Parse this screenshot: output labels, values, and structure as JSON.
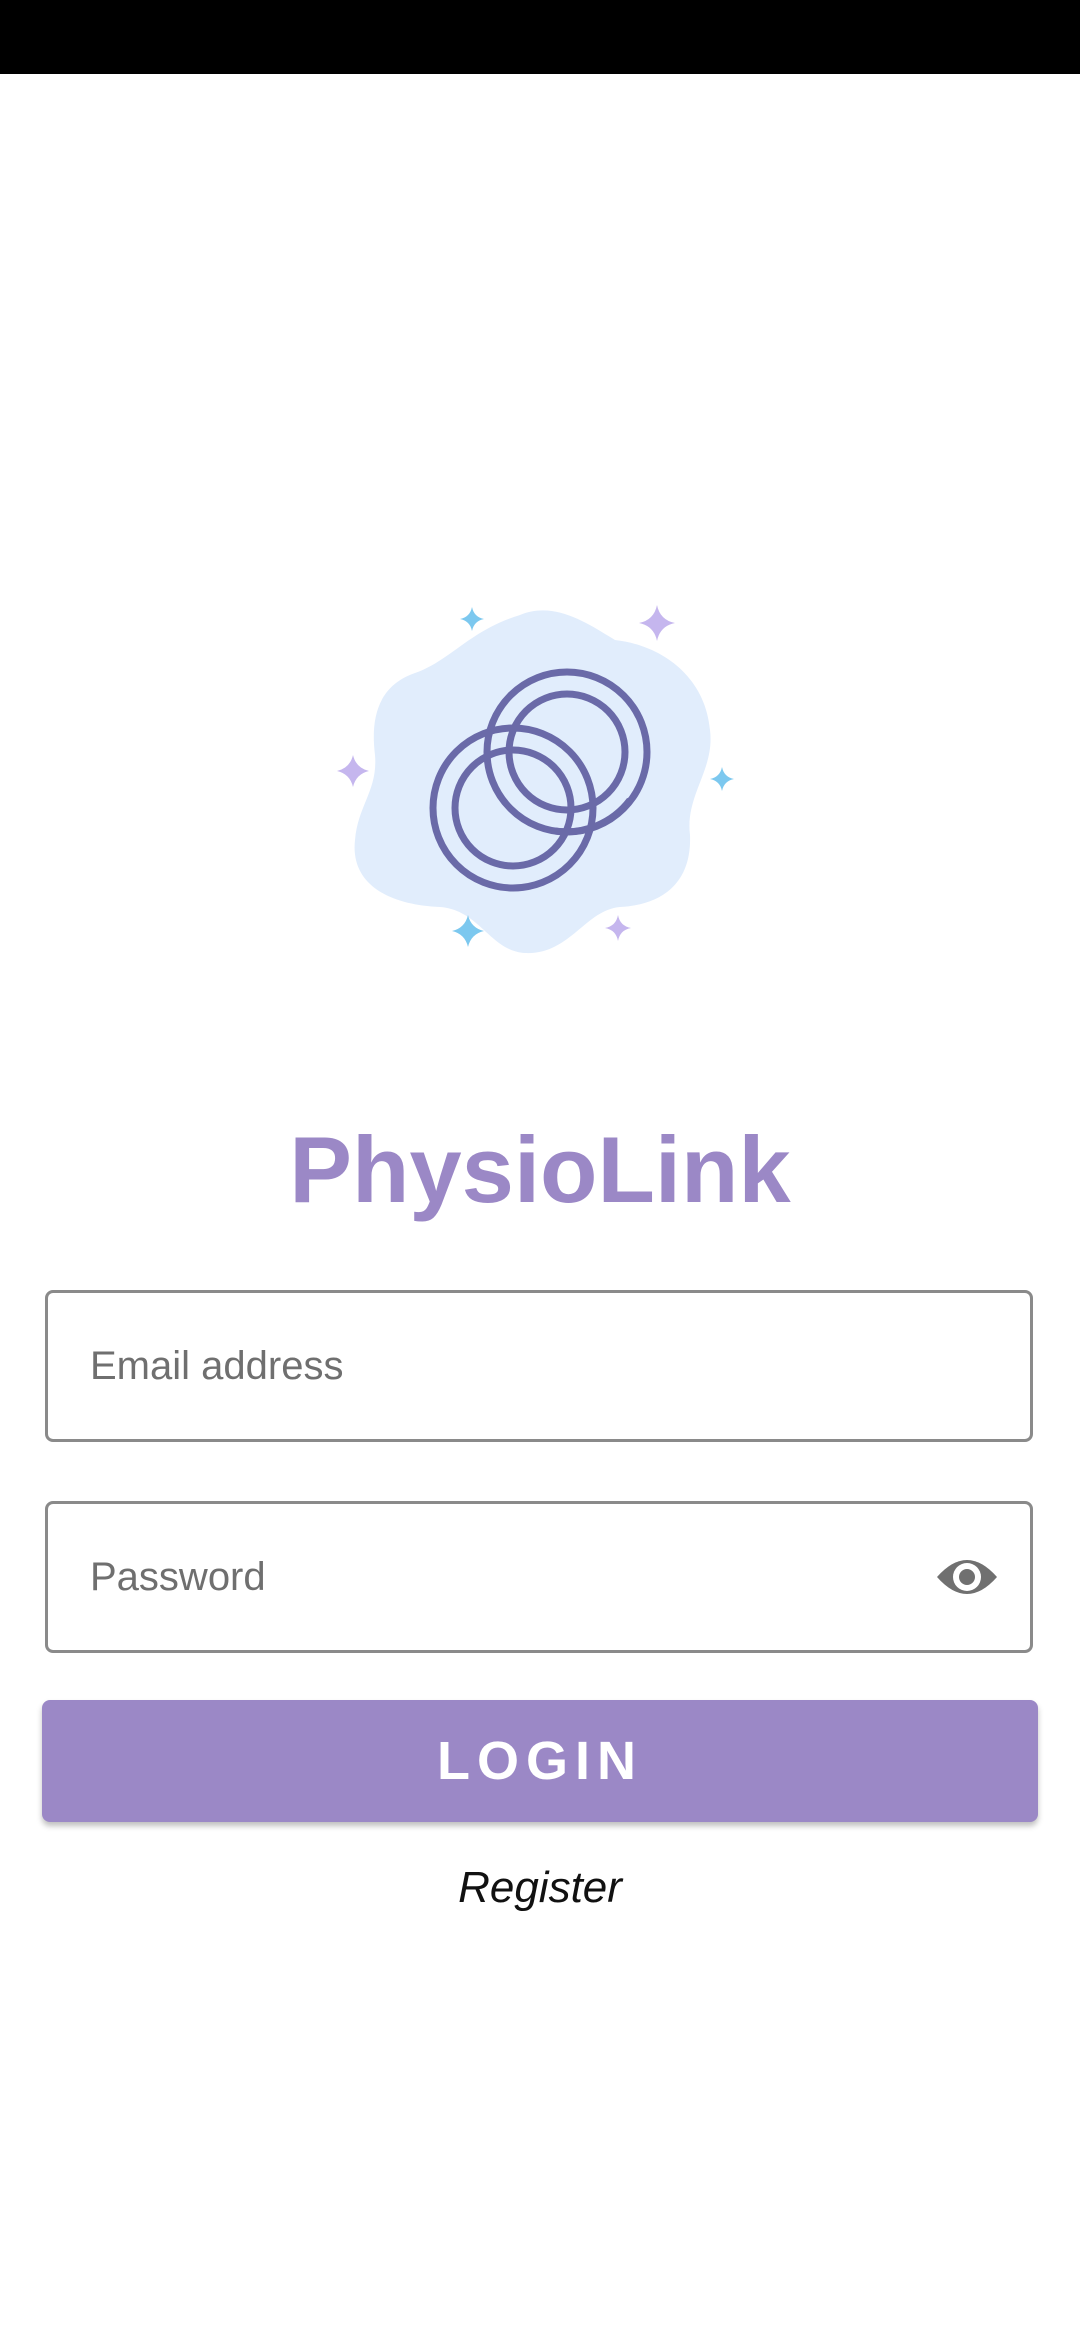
{
  "app": {
    "title": "PhysioLink",
    "logo_icon": "linked-rings-icon"
  },
  "form": {
    "email_placeholder": "Email address",
    "email_value": "",
    "password_placeholder": "Password",
    "password_value": "",
    "password_toggle_icon": "eye-icon",
    "login_label": "LOGIN",
    "register_label": "Register"
  },
  "colors": {
    "brand": "#9b88c6",
    "logo_blob": "#e1edfc",
    "logo_rings": "#6a6aa8",
    "sparkle_purple": "#c5b6ee",
    "sparkle_blue": "#7cc8ef",
    "status_bar": "#000000"
  }
}
